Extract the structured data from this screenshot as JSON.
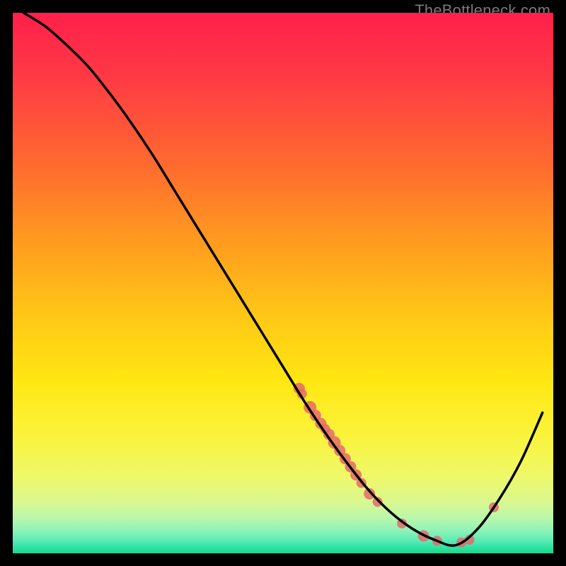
{
  "attribution": "TheBottleneck.com",
  "chart_data": {
    "type": "line",
    "title": "",
    "xlabel": "",
    "ylabel": "",
    "xlim": [
      0,
      100
    ],
    "ylim": [
      0,
      100
    ],
    "grid": false,
    "legend": false,
    "gradient_stops": [
      {
        "offset": 0.0,
        "color": "#ff1f4b"
      },
      {
        "offset": 0.12,
        "color": "#ff3a44"
      },
      {
        "offset": 0.28,
        "color": "#ff6a2f"
      },
      {
        "offset": 0.42,
        "color": "#ff9a1f"
      },
      {
        "offset": 0.55,
        "color": "#ffc416"
      },
      {
        "offset": 0.68,
        "color": "#ffe712"
      },
      {
        "offset": 0.78,
        "color": "#fbf33a"
      },
      {
        "offset": 0.86,
        "color": "#eef86a"
      },
      {
        "offset": 0.905,
        "color": "#d9f88f"
      },
      {
        "offset": 0.935,
        "color": "#b9f7ac"
      },
      {
        "offset": 0.958,
        "color": "#8ef3b7"
      },
      {
        "offset": 0.975,
        "color": "#5fedb6"
      },
      {
        "offset": 0.988,
        "color": "#33e3a5"
      },
      {
        "offset": 1.0,
        "color": "#17d98f"
      }
    ],
    "series": [
      {
        "name": "bottleneck-curve",
        "stroke": "#000000",
        "x": [
          2,
          6,
          10,
          14,
          18,
          22,
          26,
          30,
          34,
          38,
          42,
          46,
          50,
          54,
          58,
          62,
          66,
          70,
          74,
          78,
          82,
          86,
          90,
          94,
          98
        ],
        "values": [
          100,
          97.5,
          94,
          90,
          85,
          79.5,
          73.5,
          67,
          60.5,
          54,
          47.5,
          41,
          34.5,
          28,
          22,
          16.5,
          11.5,
          7.5,
          4.5,
          2.5,
          1.5,
          4.5,
          10,
          17,
          26
        ]
      }
    ],
    "scatter": {
      "name": "benchmark-points",
      "color": "#e46a6a",
      "points": [
        {
          "x": 53,
          "y": 30.5,
          "r": 8
        },
        {
          "x": 53.5,
          "y": 29.5,
          "r": 7
        },
        {
          "x": 55.0,
          "y": 27.0,
          "r": 9
        },
        {
          "x": 56.0,
          "y": 25.5,
          "r": 8
        },
        {
          "x": 57.0,
          "y": 24.0,
          "r": 8
        },
        {
          "x": 57.8,
          "y": 23.0,
          "r": 7
        },
        {
          "x": 58.5,
          "y": 22.0,
          "r": 8
        },
        {
          "x": 59.5,
          "y": 20.5,
          "r": 9
        },
        {
          "x": 60.5,
          "y": 19.0,
          "r": 8
        },
        {
          "x": 61.5,
          "y": 17.5,
          "r": 8
        },
        {
          "x": 62.5,
          "y": 16.0,
          "r": 8
        },
        {
          "x": 63.5,
          "y": 14.5,
          "r": 8
        },
        {
          "x": 64.5,
          "y": 13.0,
          "r": 7
        },
        {
          "x": 66.0,
          "y": 11.0,
          "r": 8
        },
        {
          "x": 67.5,
          "y": 9.5,
          "r": 7
        },
        {
          "x": 72.0,
          "y": 5.5,
          "r": 7
        },
        {
          "x": 76.0,
          "y": 3.2,
          "r": 8
        },
        {
          "x": 78.5,
          "y": 2.3,
          "r": 7
        },
        {
          "x": 83.0,
          "y": 2.0,
          "r": 7
        },
        {
          "x": 84.5,
          "y": 2.5,
          "r": 7
        },
        {
          "x": 89.0,
          "y": 8.5,
          "r": 7
        }
      ]
    }
  }
}
